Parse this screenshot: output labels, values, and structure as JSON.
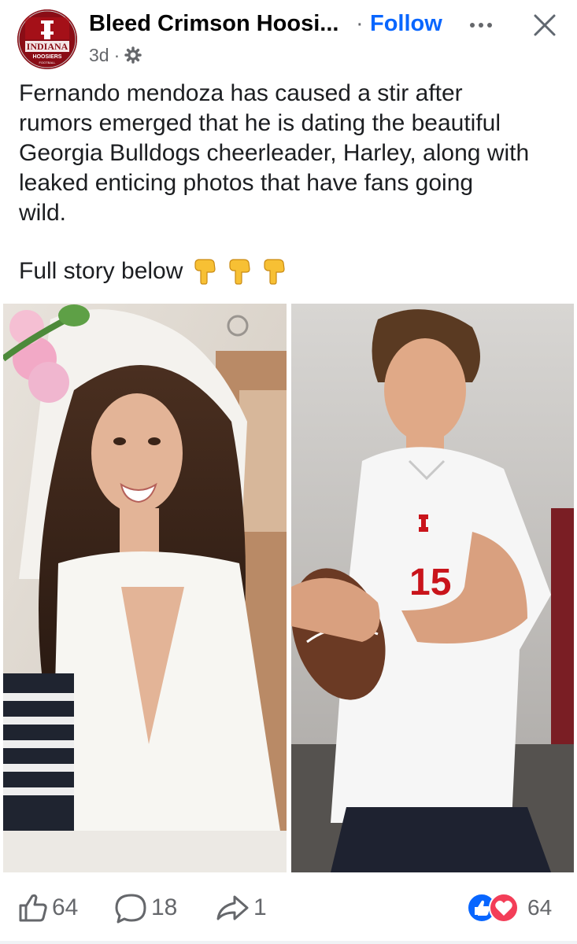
{
  "header": {
    "page_name": "Bleed Crimson Hoosi...",
    "separator": "·",
    "follow_label": "Follow",
    "time": "3d",
    "time_separator": "·",
    "avatar_text_top": "INDIANA",
    "avatar_text_bottom": "HOOSIERS",
    "avatar_text_small": "FOOTBALL"
  },
  "post": {
    "body": "Fernando mendoza has caused a stir after\nrumors emerged that he is dating the beautiful\nGeorgia Bulldogs cheerleader, Harley, along with\nleaked enticing photos that have fans going\nwild.",
    "story_line": "Full story below",
    "story_emoji": [
      "pointing-down-hand",
      "pointing-down-hand",
      "pointing-down-hand"
    ]
  },
  "photos": {
    "right_jersey_number": "15"
  },
  "actions": {
    "like_count": "64",
    "comment_count": "18",
    "share_count": "1",
    "reaction_count": "64"
  },
  "icons": {
    "audience": "gear-icon",
    "more": "more-dots-icon",
    "close": "close-icon",
    "like": "thumbs-up-icon",
    "comment": "comment-icon",
    "share": "share-icon",
    "like_reaction": "like-reaction-icon",
    "love_reaction": "love-reaction-icon"
  },
  "colors": {
    "accent": "#0866ff",
    "crimson": "#990000",
    "secondary_text": "#65676b",
    "love": "#f33e58"
  }
}
